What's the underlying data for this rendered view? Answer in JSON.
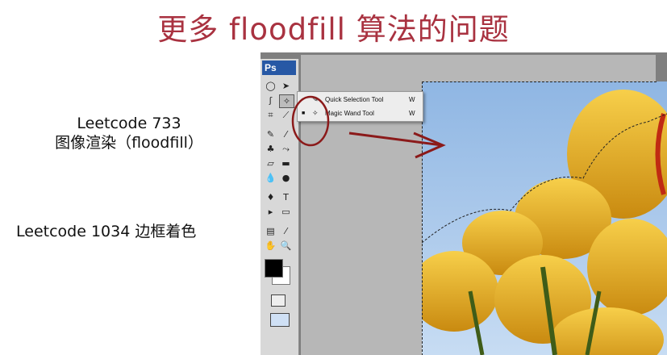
{
  "slide": {
    "title": "更多 floodfill 算法的问题",
    "note1_line1": "Leetcode 733",
    "note1_line2": "图像渲染（floodfill）",
    "note2": "Leetcode 1034 边框着色"
  },
  "photoshop": {
    "logo": "Ps",
    "flyout": {
      "items": [
        {
          "label": "Quick Selection Tool",
          "shortcut": "W",
          "icon": "quick-selection-icon",
          "selected": false
        },
        {
          "label": "Magic Wand Tool",
          "shortcut": "W",
          "icon": "magic-wand-icon",
          "selected": true
        }
      ]
    },
    "tools": [
      "marquee-icon",
      "move-icon",
      "lasso-icon",
      "magic-wand-icon",
      "crop-icon",
      "slice-icon",
      "healing-icon",
      "brush-icon",
      "stamp-icon",
      "history-brush-icon",
      "eraser-icon",
      "gradient-icon",
      "blur-icon",
      "dodge-icon",
      "pen-icon",
      "type-icon",
      "path-selection-icon",
      "shape-icon",
      "notes-icon",
      "eyedropper-icon",
      "hand-icon",
      "zoom-icon"
    ],
    "tool_glyphs": [
      "◯",
      "➤",
      "ʃ",
      "✧",
      "⌗",
      "⟋",
      "✎",
      "⁄",
      "♣",
      "⤳",
      "▱",
      "▬",
      "💧",
      "●",
      "♦",
      "T",
      "▸",
      "▭",
      "▤",
      "⁄",
      "✋",
      "🔍"
    ]
  },
  "colors": {
    "title": "#a93240",
    "annotation": "#8b1a1a",
    "petal": "#f2b824",
    "sky": "#8fb6e3"
  }
}
